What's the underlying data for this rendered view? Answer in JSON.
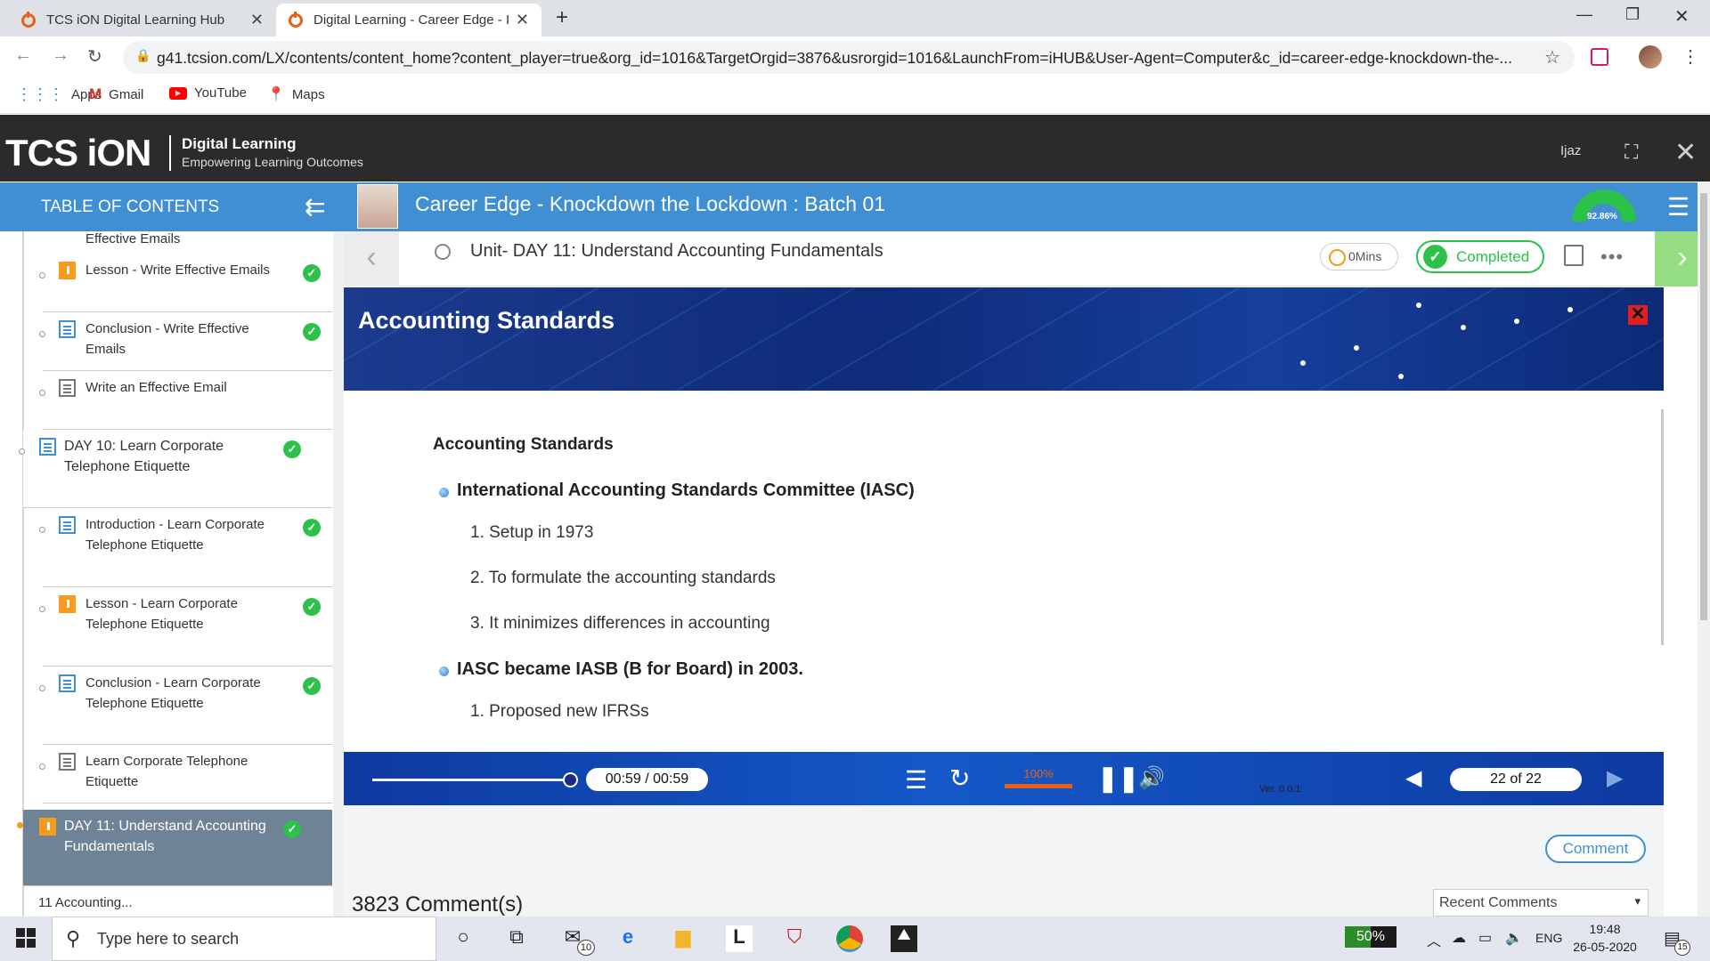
{
  "browser": {
    "tabs": [
      {
        "title": "TCS iON Digital Learning Hub"
      },
      {
        "title": "Digital Learning - Career Edge - I"
      }
    ],
    "url": "g41.tcsion.com/LX/contents/content_home?content_player=true&org_id=1016&TargetOrgid=3876&usrorgid=1016&LaunchFrom=iHUB&User-Agent=Computer&c_id=career-edge-knockdown-the-...",
    "bookmarks": [
      {
        "label": "Apps",
        "icon": "apps-grid-icon"
      },
      {
        "label": "Gmail",
        "icon": "gmail-icon"
      },
      {
        "label": "YouTube",
        "icon": "youtube-icon"
      },
      {
        "label": "Maps",
        "icon": "maps-pin-icon"
      }
    ]
  },
  "app": {
    "logo": "TCS iON",
    "logo_line1": "Digital Learning",
    "logo_line2": "Empowering Learning Outcomes",
    "user": "Ijaz",
    "toc_label": "TABLE OF CONTENTS",
    "course_title": "Career Edge - Knockdown the Lockdown : Batch 01",
    "progress_percent": 92.86,
    "progress_label": "92.86%",
    "accent": "#3f8fd2",
    "success": "#2cc24a"
  },
  "toc": {
    "cut_label": "Effective Emails",
    "items": [
      {
        "label": "Lesson - Write Effective Emails",
        "icon": "lesson-icon",
        "done": true
      },
      {
        "label": "Conclusion - Write Effective Emails",
        "icon": "document-icon",
        "done": true
      },
      {
        "label": "Write an Effective Email",
        "icon": "list-icon",
        "done": false
      },
      {
        "label": "DAY 10: Learn Corporate Telephone Etiquette",
        "icon": "document-icon",
        "done": true
      },
      {
        "label": "Introduction - Learn Corporate Telephone Etiquette",
        "icon": "document-icon",
        "done": true
      },
      {
        "label": "Lesson - Learn Corporate Telephone Etiquette",
        "icon": "lesson-icon",
        "done": true
      },
      {
        "label": "Conclusion - Learn Corporate Telephone Etiquette",
        "icon": "document-icon",
        "done": true
      },
      {
        "label": "Learn Corporate Telephone Etiquette",
        "icon": "list-icon",
        "done": false
      },
      {
        "label": "DAY 11: Understand Accounting Fundamentals",
        "icon": "lesson-icon",
        "done": true
      }
    ],
    "more_label": "11 Accounting..."
  },
  "unit": {
    "title": "Unit- DAY 11: Understand Accounting Fundamentals",
    "mins": "0Mins",
    "status": "Completed"
  },
  "slide": {
    "banner_title": "Accounting Standards",
    "heading": "Accounting Standards",
    "bullets": [
      "International Accounting Standards Committee (IASC)",
      "IASC became IASB (B for Board) in 2003."
    ],
    "points_a": [
      "1. Setup in 1973",
      "2. To formulate the accounting standards",
      "3. It minimizes differences in accounting"
    ],
    "points_b": [
      "1. Proposed new IFRSs"
    ]
  },
  "player": {
    "time": "00:59 / 00:59",
    "seek_fraction": 1.0,
    "volume": "100%",
    "version": "Ver. 0.0.1",
    "page": "22 of 22"
  },
  "comments": {
    "button": "Comment",
    "count": "3823 Comment(s)",
    "sort": "Recent Comments"
  },
  "taskbar": {
    "search_placeholder": "Type here to search",
    "mail_badge": "10",
    "battery": "50%",
    "lang": "ENG",
    "time": "19:48",
    "date": "26-05-2020",
    "notif_count": "15"
  }
}
